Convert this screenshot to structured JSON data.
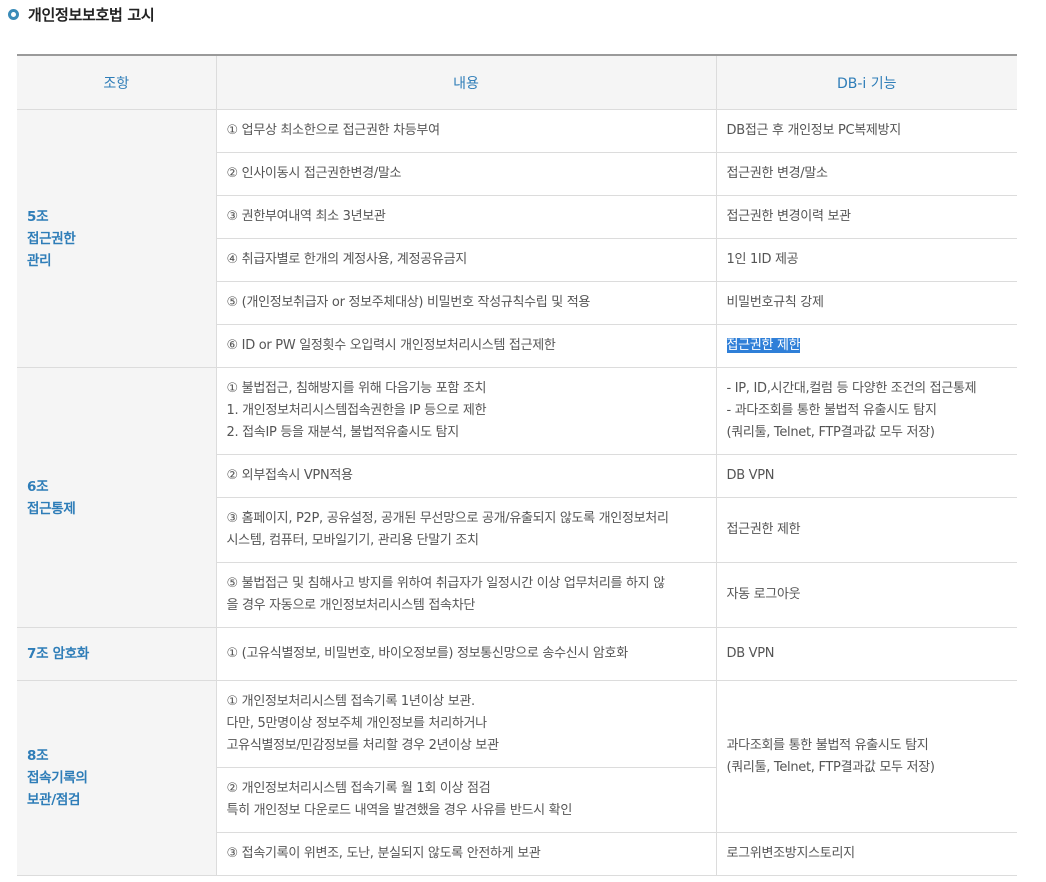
{
  "title": "개인정보보호법 고시",
  "headers": {
    "article": "조항",
    "content": "내용",
    "function": "DB-i 기능"
  },
  "art5": {
    "label_lines": [
      "5조",
      "접근권한",
      "관리"
    ],
    "rows": [
      {
        "content": "① 업무상 최소한으로 접근권한 차등부여",
        "function": "DB접근 후 개인정보 PC복제방지"
      },
      {
        "content": "② 인사이동시 접근권한변경/말소",
        "function": "접근권한 변경/말소"
      },
      {
        "content": "③ 권한부여내역 최소 3년보관",
        "function": "접근권한 변경이력 보관"
      },
      {
        "content": "④ 취급자별로 한개의 계정사용, 계정공유금지",
        "function": "1인 1ID 제공"
      },
      {
        "content": "⑤ (개인정보취급자 or 정보주체대상) 비밀번호 작성규칙수립 및 적용",
        "function": "비밀번호규칙 강제"
      },
      {
        "content": "⑥ ID or PW 일정횟수 오입력시 개인정보처리시스템 접근제한",
        "function": "접근권한 제한"
      }
    ]
  },
  "art6": {
    "label_lines": [
      "6조",
      "접근통제"
    ],
    "row1": {
      "content_lines": [
        "① 불법접근, 침해방지를 위해 다음기능 포함 조치",
        "1. 개인정보처리시스템접속권한을 IP 등으로 제한",
        "2. 접속IP 등을 재분석, 불법적유출시도 탐지"
      ],
      "function_lines": [
        "- IP, ID,시간대,컬럼 등 다양한 조건의 접근통제",
        "- 과다조회를 통한 불법적 유출시도 탐지",
        "(쿼리툴, Telnet, FTP결과값 모두 저장)"
      ]
    },
    "row2": {
      "content": "② 외부접속시 VPN적용",
      "function": "DB VPN"
    },
    "row3": {
      "content_lines": [
        "③ 홈페이지, P2P, 공유설정, 공개된 무선망으로 공개/유출되지 않도록 개인정보처리",
        "시스템, 컴퓨터, 모바일기기, 관리용 단말기 조치"
      ],
      "function": "접근권한 제한"
    },
    "row4": {
      "content_lines": [
        "⑤ 불법접근 및 침해사고 방지를 위하여 취급자가 일정시간 이상 업무처리를 하지 않",
        "을 경우 자동으로 개인정보처리시스템 접속차단"
      ],
      "function": "자동 로그아웃"
    }
  },
  "art7": {
    "label": "7조 암호화",
    "content": "① (고유식별정보, 비밀번호, 바이오정보를) 정보통신망으로 송수신시 암호화",
    "function": "DB VPN"
  },
  "art8": {
    "label_lines": [
      "8조",
      "접속기록의",
      "보관/점검"
    ],
    "row1_lines": [
      "① 개인정보처리시스템 접속기록 1년이상 보관.",
      "다만, 5만명이상 정보주체 개인정보를 처리하거나",
      "고유식별정보/민감정보를 처리할 경우 2년이상 보관"
    ],
    "row2_lines": [
      "② 개인정보처리시스템 접속기록 월 1회 이상 점검",
      "특히 개인정보 다운로드 내역을 발견했을 경우 사유를 반드시 확인"
    ],
    "function12_lines": [
      "과다조회를 통한 불법적 유출시도 탐지",
      "(쿼리툴, Telnet, FTP결과값 모두 저장)"
    ],
    "row3": {
      "content": "③ 접속기록이 위변조, 도난, 분실되지 않도록 안전하게 보관",
      "function": "로그위변조방지스토리지"
    }
  },
  "colors": {
    "accent": "#2e7db8",
    "highlight": "#2f7fd8",
    "header_bg": "#f5f5f5"
  }
}
